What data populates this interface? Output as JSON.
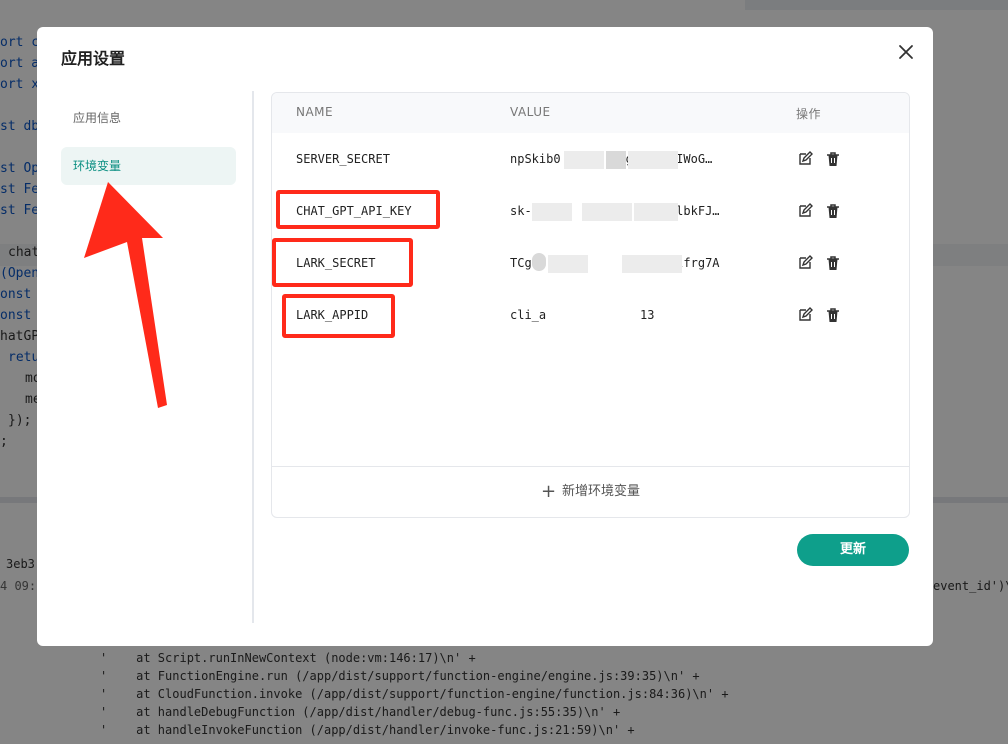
{
  "background_editor": {
    "code_fragments": [
      "ort c",
      "ort a",
      "ort x",
      "st db",
      "st Op",
      "st Fe",
      "st Fe",
      "chat",
      "(Open",
      "onst",
      "onst",
      "hatGP",
      "retu",
      "mo",
      "me",
      "});",
      ";"
    ],
    "log_prefix": "3eb3",
    "log_time": "4 09:1",
    "log_right": "event_id')\\",
    "log_lines": [
      "'    at Script.runInNewContext (node:vm:146:17)\\n' +",
      "'    at FunctionEngine.run (/app/dist/support/function-engine/engine.js:39:35)\\n' +",
      "'    at CloudFunction.invoke (/app/dist/support/function-engine/function.js:84:36)\\n' +",
      "'    at handleDebugFunction (/app/dist/handler/debug-func.js:55:35)\\n' +",
      "'    at handleInvokeFunction (/app/dist/handler/invoke-func.js:21:59)\\n' +"
    ]
  },
  "modal": {
    "title": "应用设置",
    "close_icon": "close-icon",
    "sidebar": [
      {
        "label": "应用信息",
        "active": false
      },
      {
        "label": "环境变量",
        "active": true
      }
    ],
    "table": {
      "headers": {
        "name": "NAME",
        "value": "VALUE",
        "actions": "操作"
      },
      "rows": [
        {
          "name": "SERVER_SECRET",
          "value": "npSkib0        _gR  .JwIWoG…"
        },
        {
          "name": "CHAT_GPT_API_KEY",
          "value": "sk-                 73BlbkFJ…"
        },
        {
          "name": "LARK_SECRET",
          "value": "TCg                  RJlfrg7A"
        },
        {
          "name": "LARK_APPID",
          "value": "cli_a             13"
        }
      ],
      "add_label": "新增环境变量"
    },
    "update_label": "更新"
  },
  "colors": {
    "accent": "#0e9f8b",
    "annotation_red": "#ff2a1a"
  },
  "icons": [
    "close-icon",
    "edit-icon",
    "trash-icon",
    "plus-icon"
  ]
}
